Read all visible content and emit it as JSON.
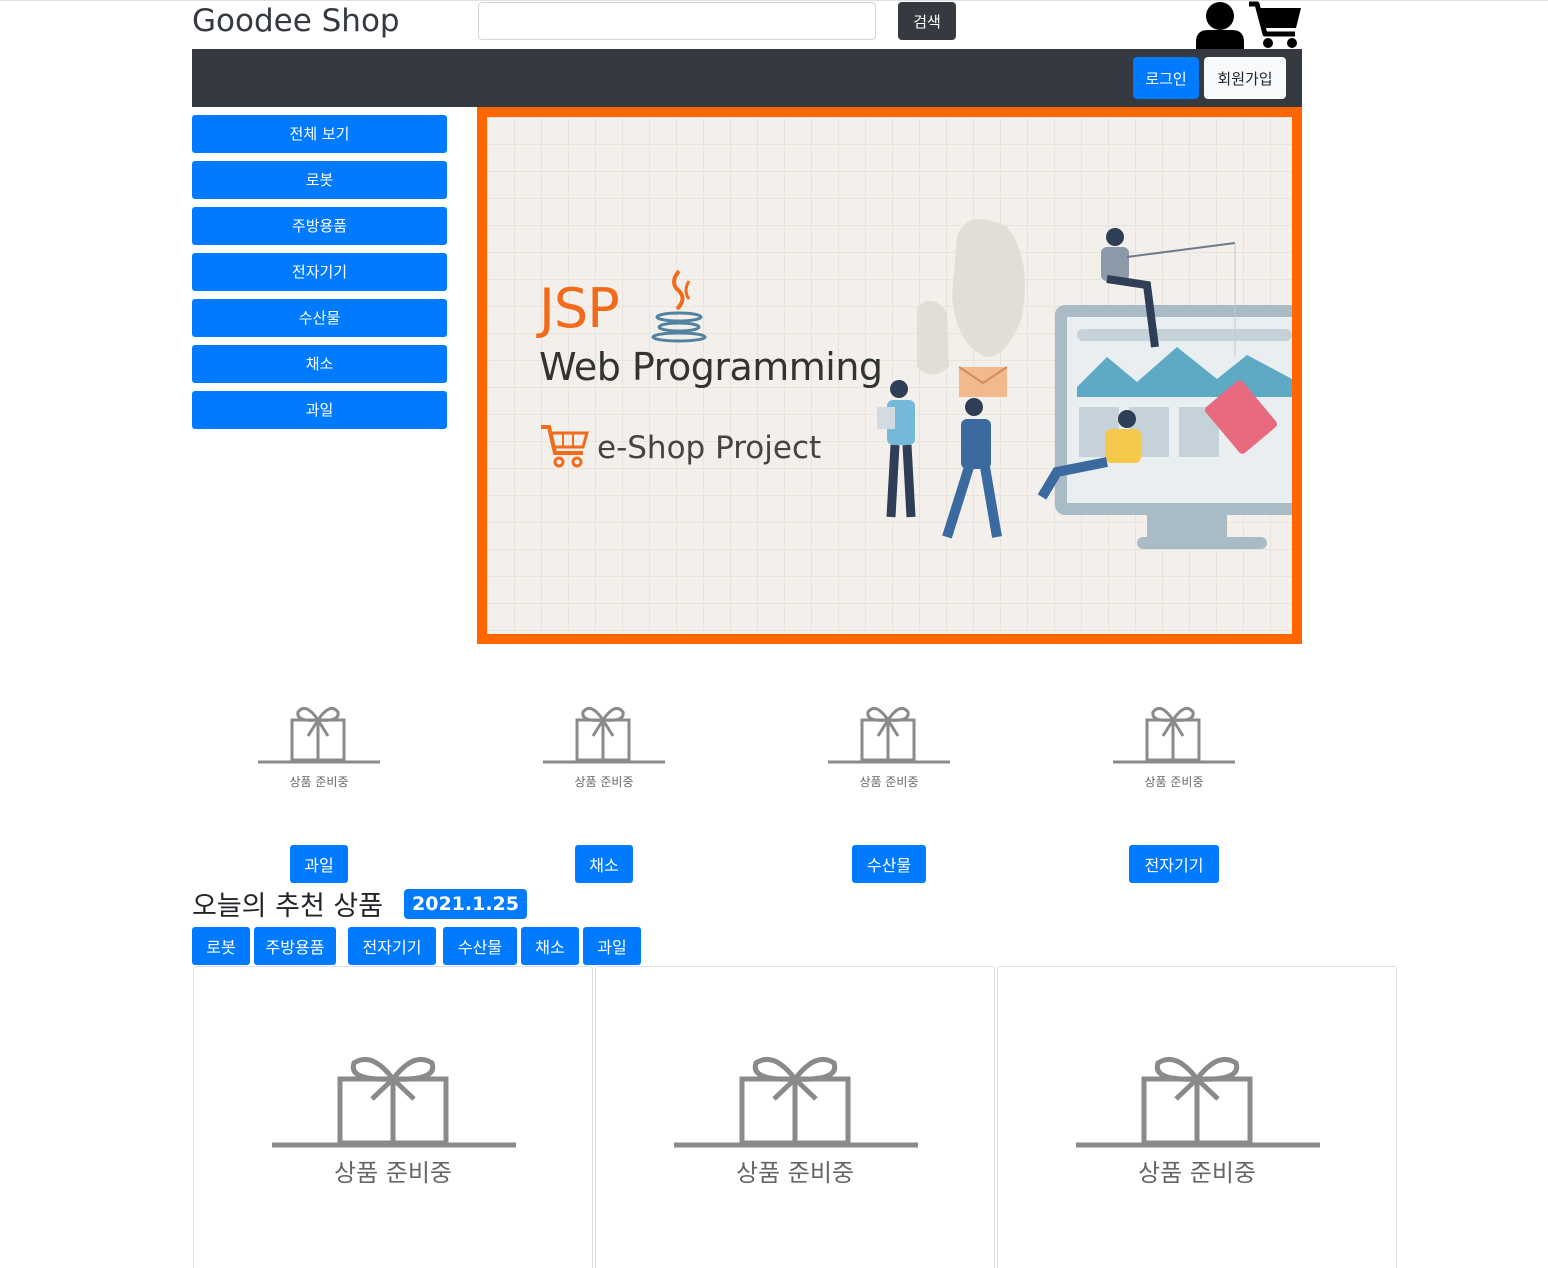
{
  "header": {
    "brand": "Goodee Shop",
    "search_placeholder": "",
    "search_button": "검색",
    "user_icon": "user-icon",
    "cart_icon": "cart-icon"
  },
  "navbar": {
    "login": "로그인",
    "join": "회원가입"
  },
  "sidebar": {
    "items": [
      {
        "label": "전체 보기"
      },
      {
        "label": "로봇"
      },
      {
        "label": "주방용품"
      },
      {
        "label": "전자기기"
      },
      {
        "label": "수산물"
      },
      {
        "label": "채소"
      },
      {
        "label": "과일"
      }
    ]
  },
  "banner": {
    "title": "JSP",
    "subtitle": "Web Programming",
    "project": "e-Shop Project",
    "border_color": "#ff6600"
  },
  "categories": [
    {
      "placeholder": "상품 준비중",
      "label": "과일"
    },
    {
      "placeholder": "상품 준비중",
      "label": "채소"
    },
    {
      "placeholder": "상품 준비중",
      "label": "수산물"
    },
    {
      "placeholder": "상품 준비중",
      "label": "전자기기"
    }
  ],
  "recommend": {
    "title": "오늘의 추천 상품",
    "date": "2021.1.25",
    "tabs": [
      {
        "label": "로봇"
      },
      {
        "label": "주방용품"
      },
      {
        "label": "전자기기"
      },
      {
        "label": "수산물"
      },
      {
        "label": "채소"
      },
      {
        "label": "과일"
      }
    ],
    "products": [
      {
        "placeholder": "상품 준비중"
      },
      {
        "placeholder": "상품 준비중"
      },
      {
        "placeholder": "상품 준비중"
      }
    ]
  },
  "colors": {
    "primary": "#007bff",
    "dark": "#343a40",
    "light": "#f8f9fa",
    "accent": "#ff6600"
  }
}
